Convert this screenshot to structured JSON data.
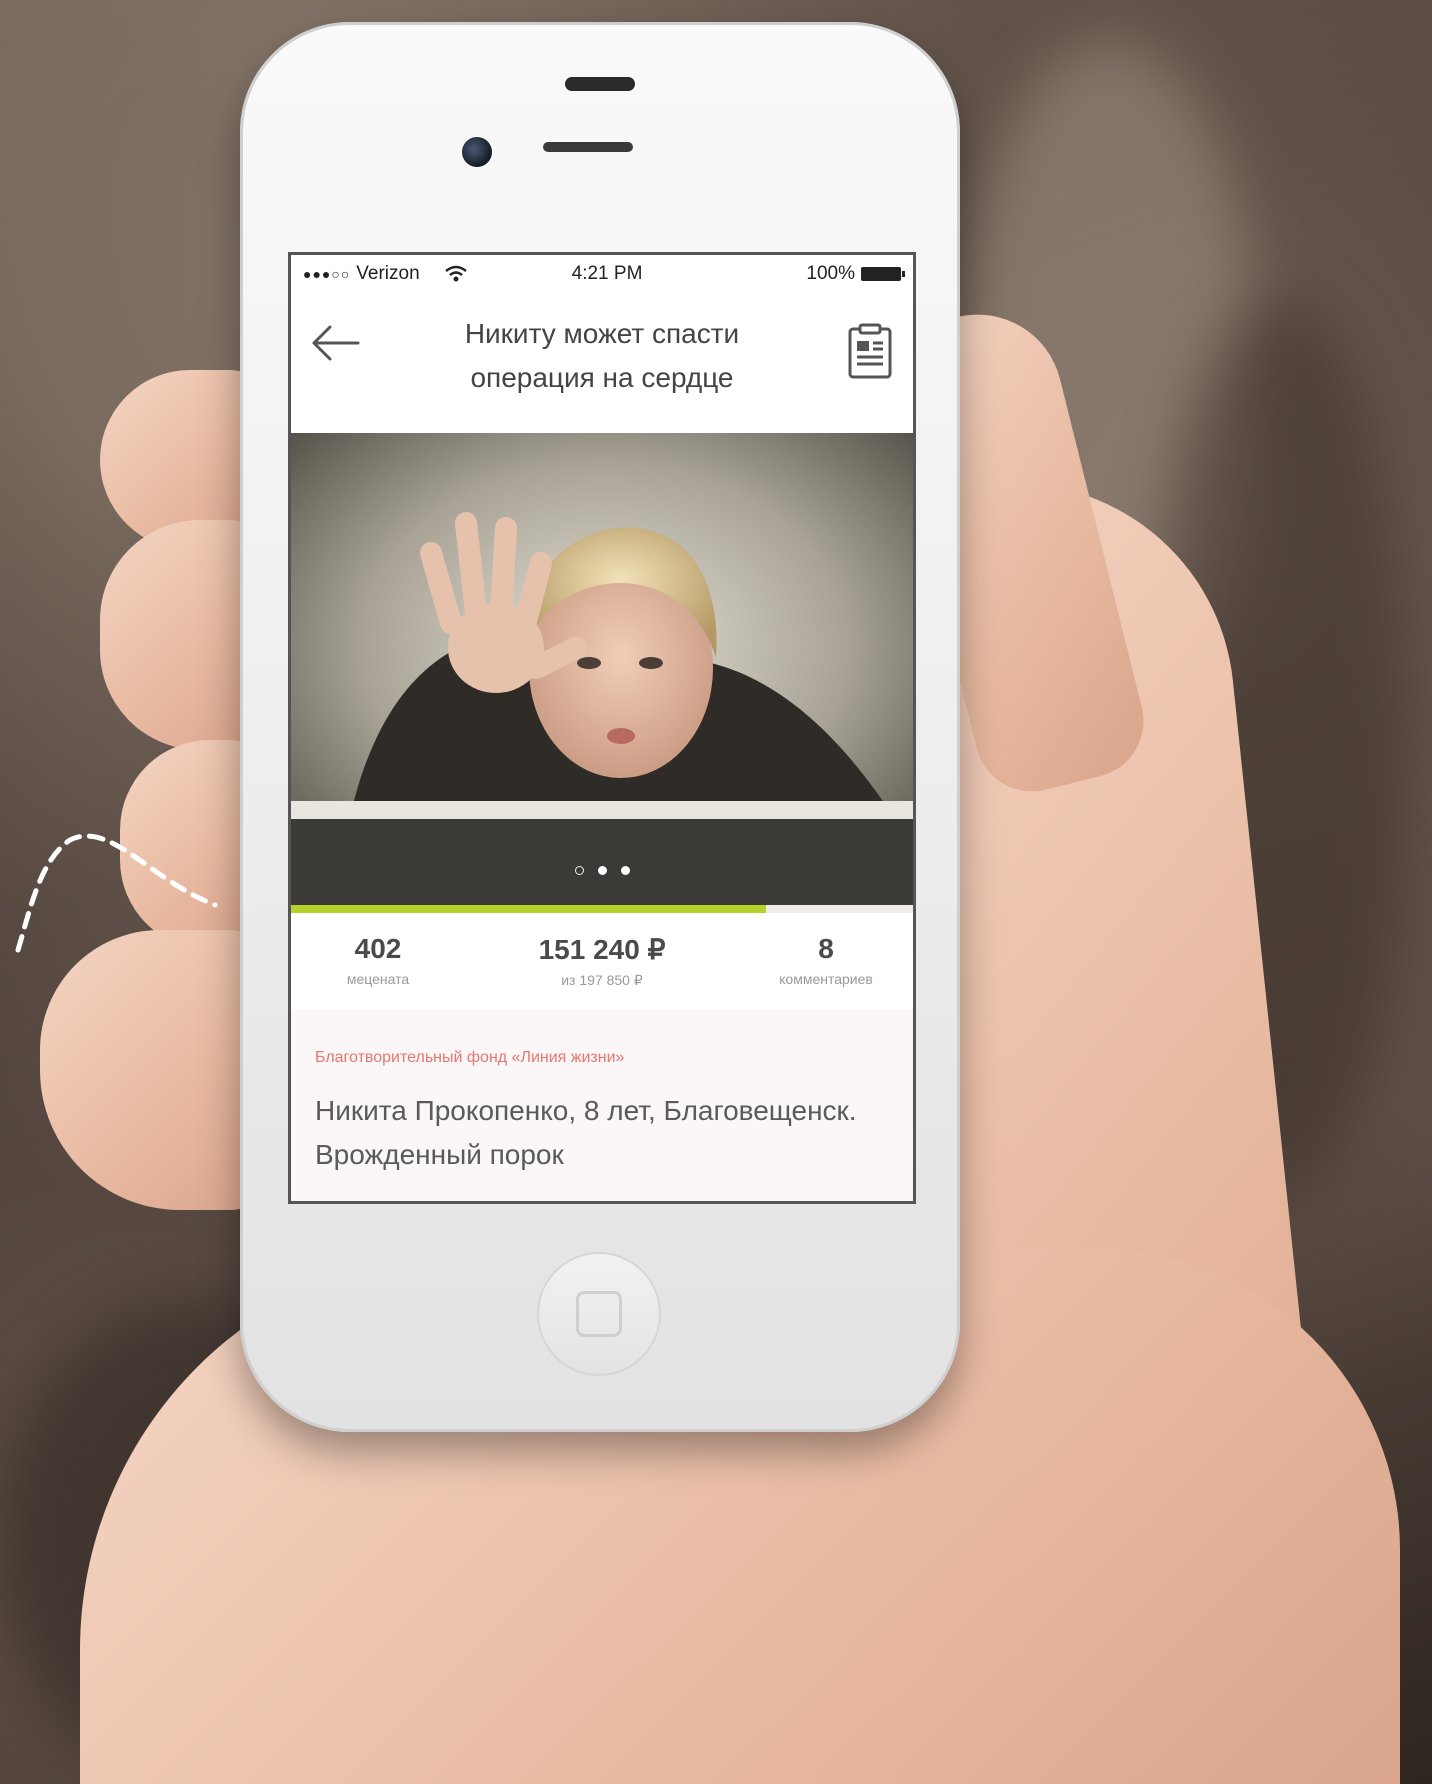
{
  "status_bar": {
    "signal_dots": "●●●○○",
    "carrier": "Verizon",
    "time": "4:21 PM",
    "battery": "100%"
  },
  "header": {
    "title": "Никиту может спасти операция на сердце",
    "back_icon": "arrow-left-icon",
    "doc_icon": "clipboard-icon"
  },
  "photo": {
    "carousel_count": 3,
    "carousel_active": 1
  },
  "progress": {
    "fraction": 0.764,
    "color": "#b5d12a"
  },
  "stats": {
    "patrons": {
      "value": "402",
      "label": "мецената"
    },
    "raised": {
      "value": "151 240 ₽",
      "label": "из 197 850 ₽"
    },
    "comments": {
      "value": "8",
      "label": "комментариев"
    }
  },
  "story": {
    "fund": "Благотворительный фонд «Линия жизни»",
    "text": "Никита Прокопенко, 8 лет, Благовещенск. Врожденный порок"
  },
  "colors": {
    "accent": "#b5d12a",
    "fund_label": "#e8776f"
  }
}
